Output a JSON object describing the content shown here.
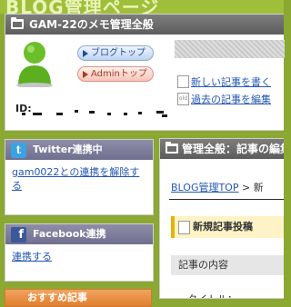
{
  "banner": {
    "logo_text": "BLOG管理ページ"
  },
  "user_panel": {
    "title": "GAM-22のメモ管理全般",
    "blog_top_button": "ブログトップ",
    "admin_top_button": "Adminトップ",
    "new_post_link": "新しい記事を書く",
    "edit_old_link": "過去の記事を編集",
    "edit_old_icon_text": "old",
    "id_label": "ID:"
  },
  "twitter_box": {
    "title": "Twitter連携中",
    "icon_glyph": "t",
    "link": "gam0022との連携を解除する"
  },
  "facebook_box": {
    "title": "Facebook連携",
    "icon_glyph": "f",
    "link": "連携する"
  },
  "orange_box": {
    "title": "おすすめ記事"
  },
  "main": {
    "title": "管理全般：記事の編集",
    "breadcrumb_home": "BLOG管理TOP",
    "breadcrumb_sep": ">",
    "breadcrumb_current": "新",
    "new_post_heading": "新規記事投稿",
    "content_heading": "記事の内容",
    "title_field_label": "タイトル："
  },
  "colors": {
    "background": "#8aa832",
    "link": "#2458b3",
    "panel_header": "#6c6c6c",
    "twitter": "#3aa3e3",
    "facebook": "#3b5998"
  }
}
